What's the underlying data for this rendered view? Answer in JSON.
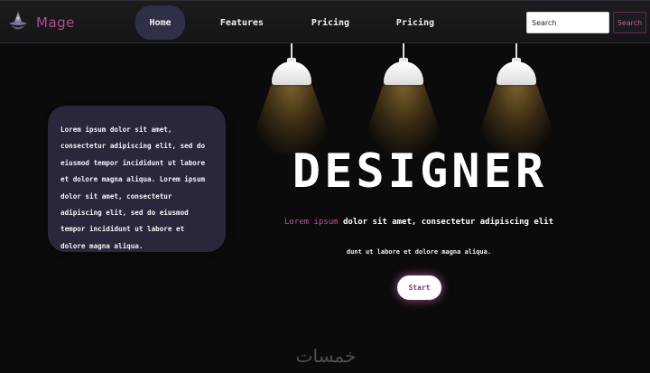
{
  "brand": {
    "name": "Mage",
    "logo_icon": "witch-hat-logo-icon"
  },
  "nav": {
    "items": [
      {
        "label": "Home",
        "active": true
      },
      {
        "label": "Features",
        "active": false
      },
      {
        "label": "Pricing",
        "active": false
      },
      {
        "label": "Pricing",
        "active": false
      }
    ]
  },
  "search": {
    "placeholder": "Search",
    "button_label": "Search"
  },
  "colors": {
    "accent_pink": "#b8549a",
    "card_bg": "#29283b",
    "nav_active_bg": "#2f2f47",
    "page_bg": "#0b0b0b"
  },
  "card": {
    "text": "Lorem ipsum dolor sit amet, consectetur adipiscing elit, sed do eiusmod tempor incididunt ut labore et dolore magna aliqua. Lorem ipsum dolor sit amet, consectetur adipiscing elit, sed do eiusmod tempor incididunt ut labore et dolore magna aliqua."
  },
  "hero": {
    "title": "DESIGNER",
    "line_pink": "Lorem ipsum",
    "line_white": " dolor sit amet, consectetur adipiscing elit",
    "subtext": "dunt ut labore et dolore magna aliqua.",
    "start_label": "Start"
  },
  "watermark": "خمسات"
}
